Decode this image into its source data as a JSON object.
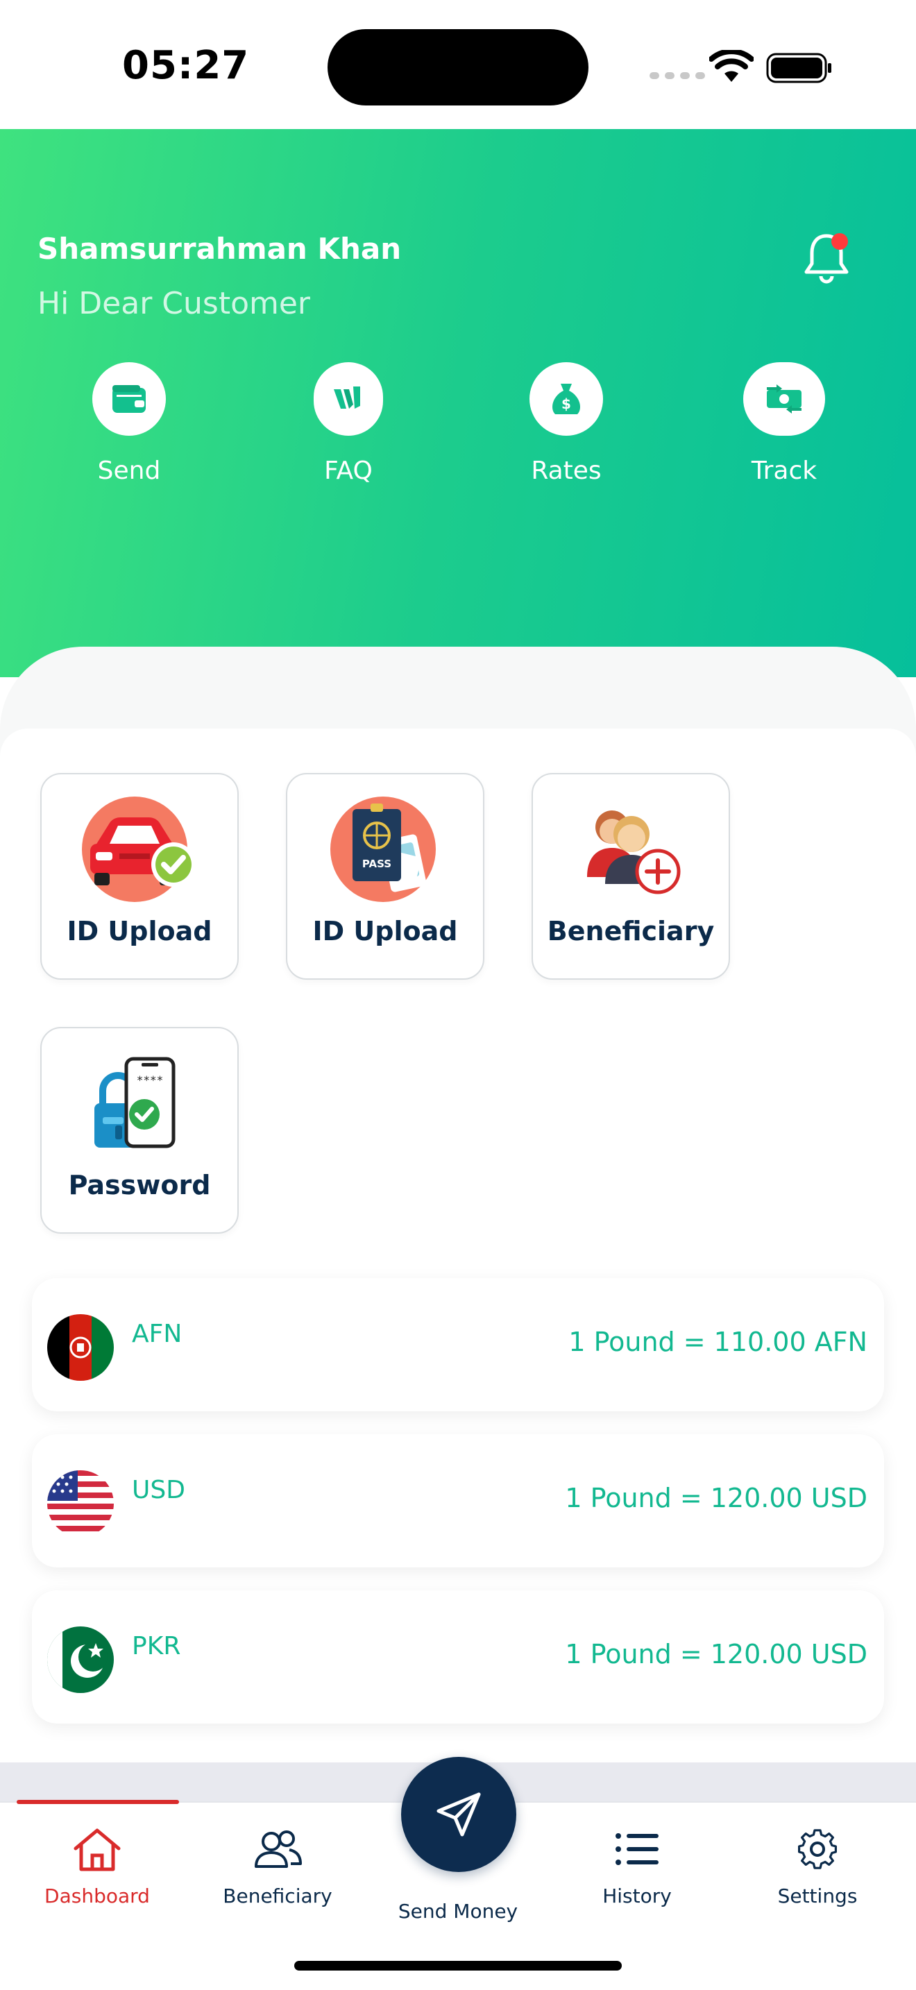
{
  "status_bar": {
    "time": "05:27"
  },
  "header": {
    "user_name": "Shamsurrahman Khan",
    "greeting": "Hi Dear Customer",
    "accent_from": "#3fe27f",
    "accent_to": "#06bf9b",
    "quick_actions": [
      {
        "label": "Send",
        "icon": "wallet-icon"
      },
      {
        "label": "FAQ",
        "icon": "faq-icon"
      },
      {
        "label": "Rates",
        "icon": "money-bag-icon"
      },
      {
        "label": "Track",
        "icon": "money-transfer-icon"
      }
    ]
  },
  "tiles": [
    {
      "label": "ID Upload",
      "icon": "driving-license-icon"
    },
    {
      "label": "ID Upload",
      "icon": "passport-icon"
    },
    {
      "label": "Beneficiary",
      "icon": "add-beneficiary-icon"
    },
    {
      "label": "Password",
      "icon": "password-lock-icon"
    }
  ],
  "rates": [
    {
      "code": "AFN",
      "rate": "1 Pound = 110.00 AFN",
      "flag": "afghanistan-flag-icon"
    },
    {
      "code": "USD",
      "rate": "1 Pound = 120.00 USD",
      "flag": "usa-flag-icon"
    },
    {
      "code": "PKR",
      "rate": "1 Pound = 120.00 USD",
      "flag": "pakistan-flag-icon"
    }
  ],
  "nav": {
    "dashboard": "Dashboard",
    "beneficiary": "Beneficiary",
    "send_money": "Send Money",
    "history": "History",
    "settings": "Settings",
    "active_color": "#d92b2b",
    "primary_color": "#0d2c4f"
  }
}
